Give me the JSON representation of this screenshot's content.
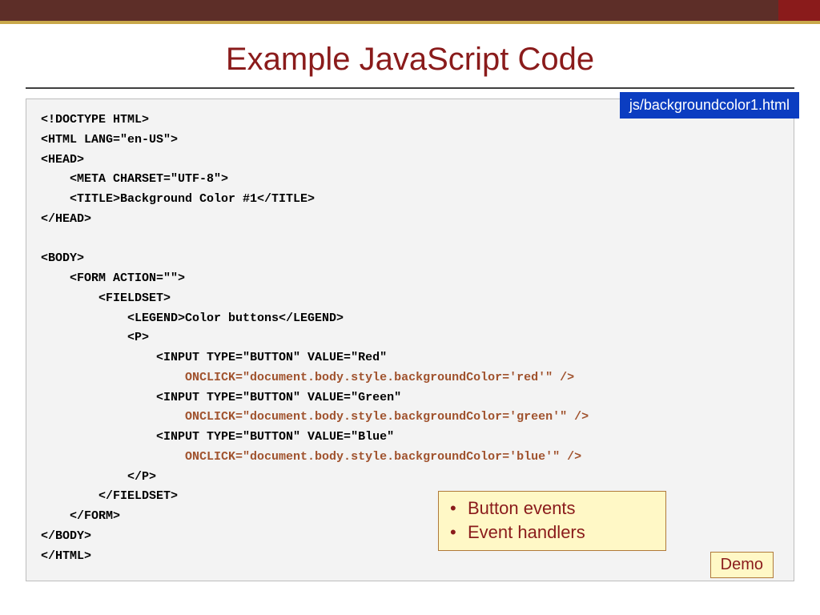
{
  "header": {
    "title": "Example JavaScript Code"
  },
  "file_label": "js/backgroundcolor1.html",
  "code": {
    "l01": "<!DOCTYPE HTML>",
    "l02": "<HTML LANG=\"en-US\">",
    "l03": "<HEAD>",
    "l04": "    <META CHARSET=\"UTF-8\">",
    "l05": "    <TITLE>Background Color #1</TITLE>",
    "l06": "</HEAD>",
    "l07": "",
    "l08": "<BODY>",
    "l09": "    <FORM ACTION=\"\">",
    "l10": "        <FIELDSET>",
    "l11": "            <LEGEND>Color buttons</LEGEND>",
    "l12": "            <P>",
    "l13": "                <INPUT TYPE=\"BUTTON\" VALUE=\"Red\"",
    "l14": "                    ONCLICK=\"document.body.style.backgroundColor='red'\" />",
    "l15": "                <INPUT TYPE=\"BUTTON\" VALUE=\"Green\"",
    "l16": "                    ONCLICK=\"document.body.style.backgroundColor='green'\" />",
    "l17": "                <INPUT TYPE=\"BUTTON\" VALUE=\"Blue\"",
    "l18": "                    ONCLICK=\"document.body.style.backgroundColor='blue'\" />",
    "l19": "            </P>",
    "l20": "        </FIELDSET>",
    "l21": "    </FORM>",
    "l22": "</BODY>",
    "l23": "</HTML>"
  },
  "notes": {
    "item1": "Button events",
    "item2": "Event handlers"
  },
  "demo_label": "Demo"
}
